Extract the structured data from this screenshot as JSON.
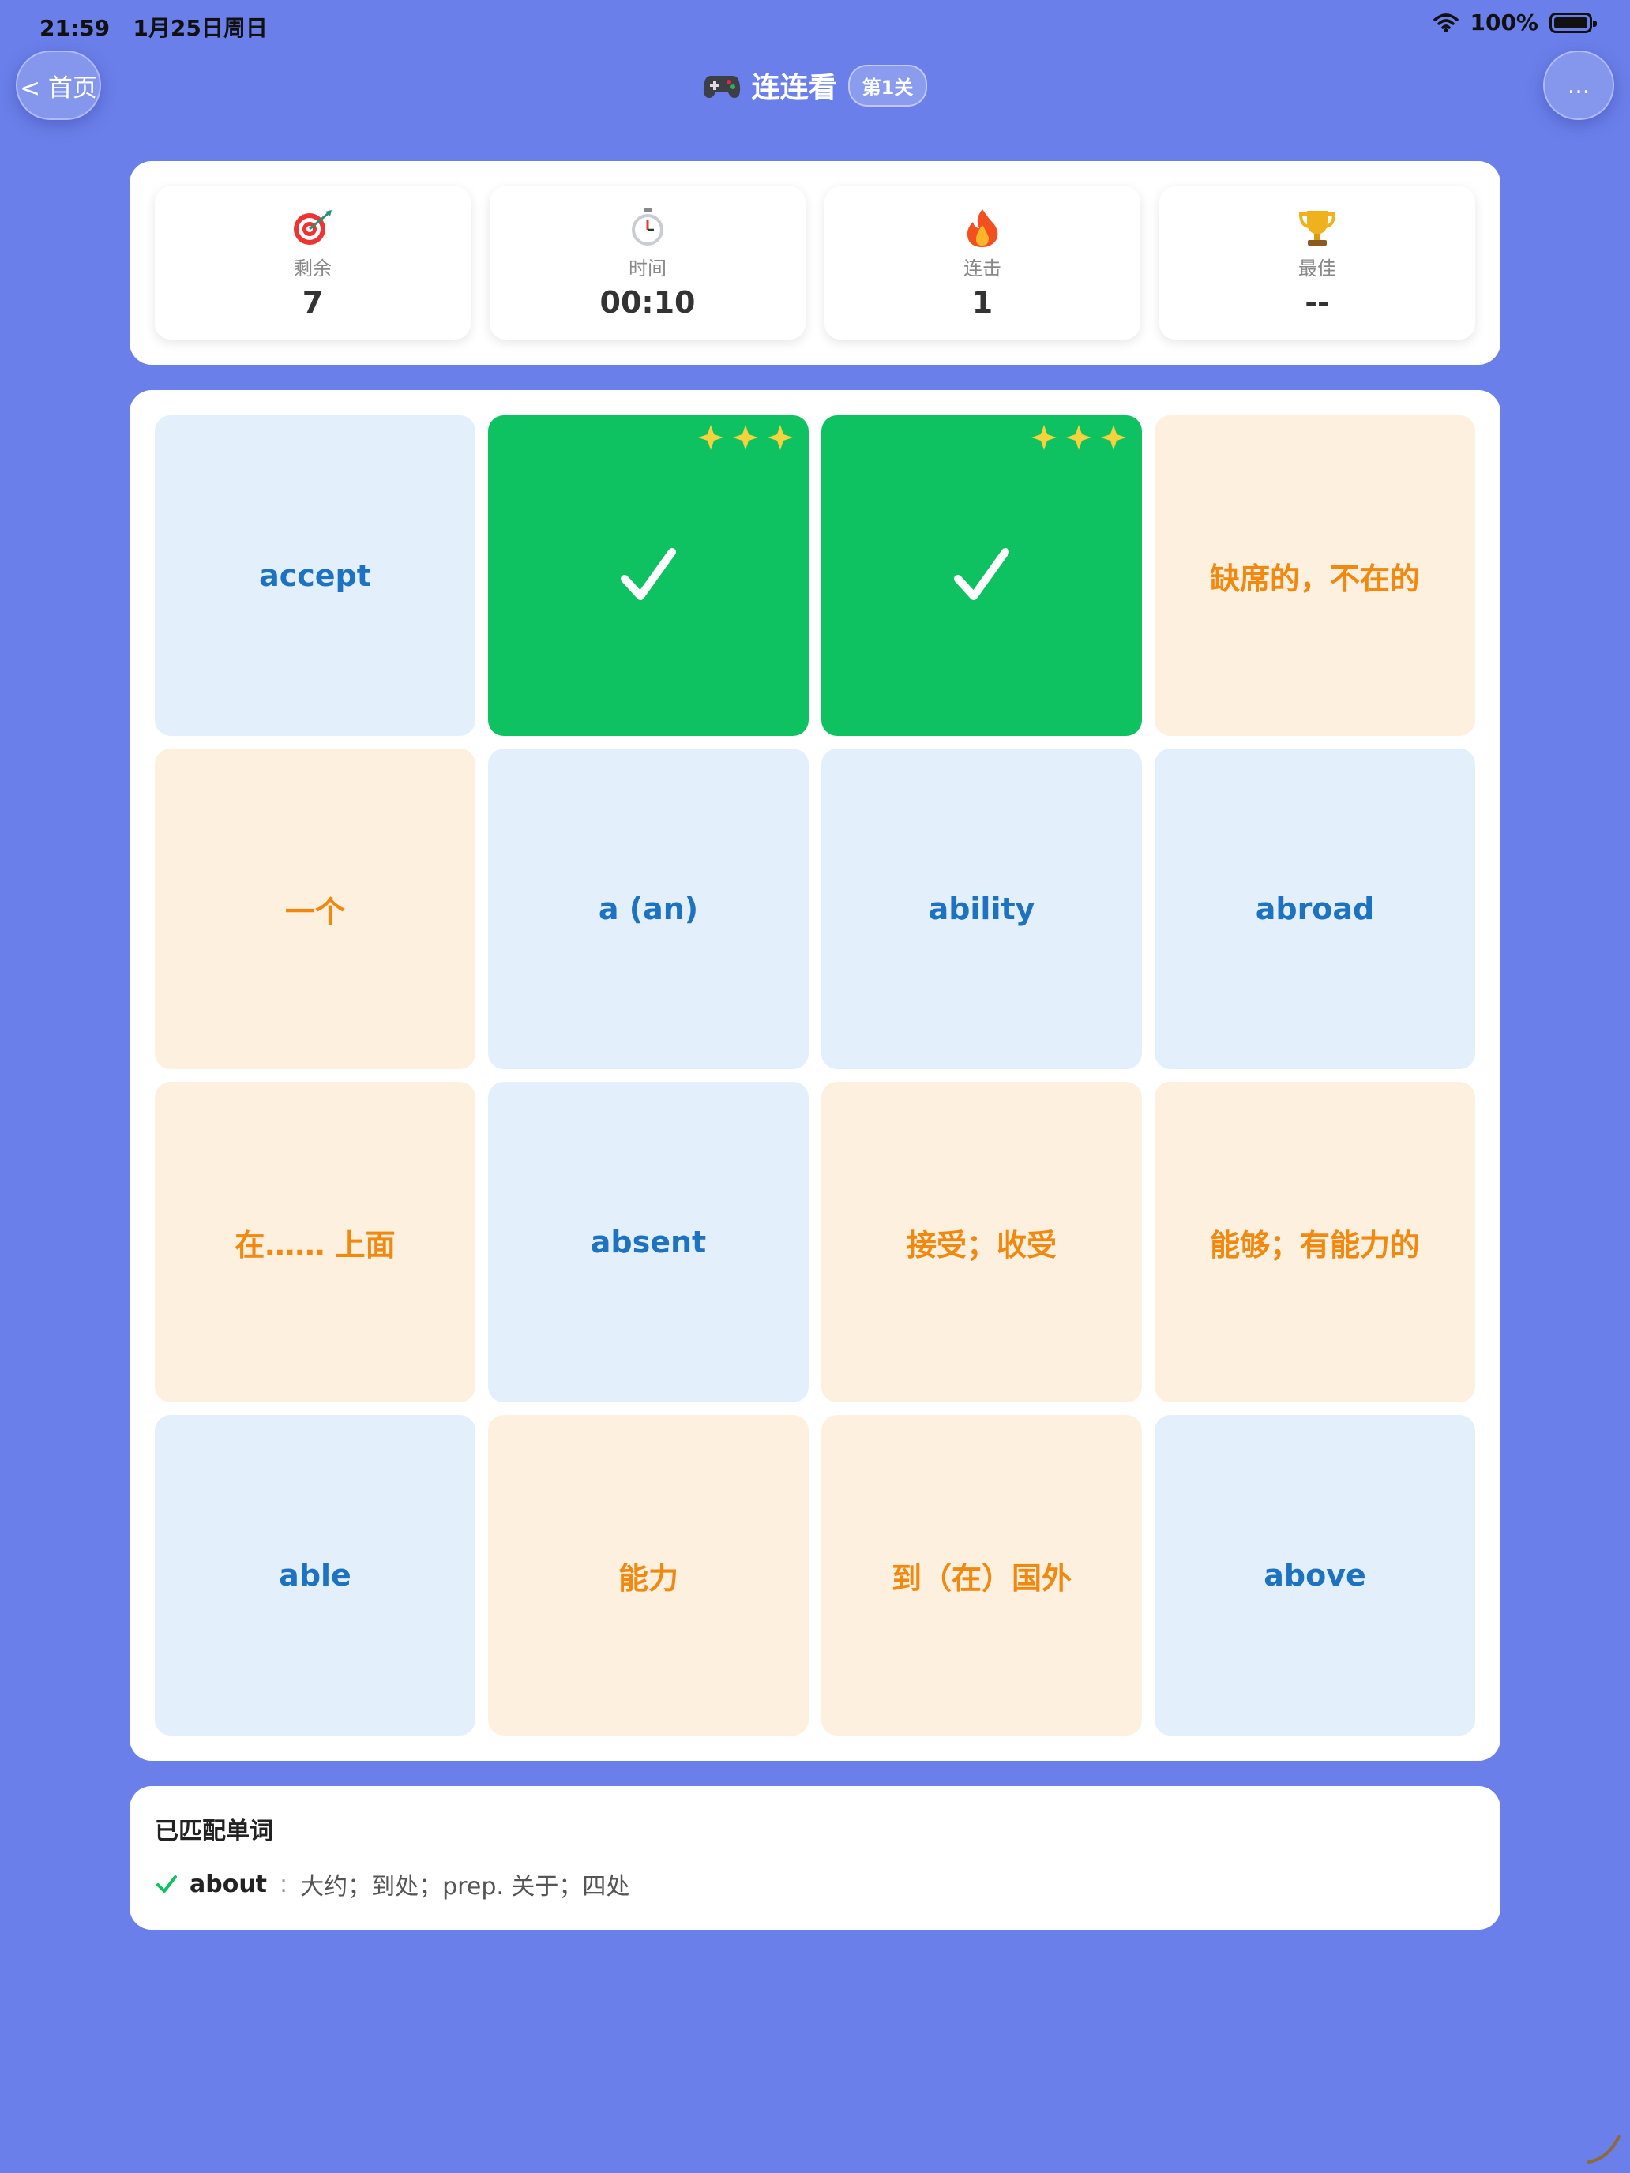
{
  "status": {
    "time": "21:59",
    "date": "1月25日周日",
    "battery": "100%"
  },
  "nav": {
    "back_label": "< 首页",
    "title": "连连看",
    "level_badge": "第1关",
    "more_label": "..."
  },
  "stats": [
    {
      "icon": "target-icon",
      "label": "剩余",
      "value": "7"
    },
    {
      "icon": "stopwatch-icon",
      "label": "时间",
      "value": "00:10"
    },
    {
      "icon": "fire-icon",
      "label": "连击",
      "value": "1"
    },
    {
      "icon": "trophy-icon",
      "label": "最佳",
      "value": "--"
    }
  ],
  "tiles": [
    {
      "text": "accept",
      "kind": "en"
    },
    {
      "text": "",
      "kind": "matched"
    },
    {
      "text": "",
      "kind": "matched"
    },
    {
      "text": "缺席的，不在的",
      "kind": "zh"
    },
    {
      "text": "一个",
      "kind": "zh"
    },
    {
      "text": "a (an)",
      "kind": "en"
    },
    {
      "text": "ability",
      "kind": "en"
    },
    {
      "text": "abroad",
      "kind": "en"
    },
    {
      "text": "在…… 上面",
      "kind": "zh"
    },
    {
      "text": "absent",
      "kind": "en"
    },
    {
      "text": "接受；收受",
      "kind": "zh"
    },
    {
      "text": "能够；有能力的",
      "kind": "zh"
    },
    {
      "text": "able",
      "kind": "en"
    },
    {
      "text": "能力",
      "kind": "zh"
    },
    {
      "text": "到（在）国外",
      "kind": "zh"
    },
    {
      "text": "above",
      "kind": "en"
    }
  ],
  "matched": {
    "title": "已匹配单词",
    "items": [
      {
        "word": "about",
        "separator": ":",
        "definition": "大约；到处；prep. 关于；四处"
      }
    ]
  },
  "colors": {
    "background": "#6b7fea",
    "english_tile": "#e3f0fb",
    "english_text": "#1e72c2",
    "chinese_tile": "#fdf0df",
    "chinese_text": "#f1880f",
    "matched_tile": "#0ec262"
  }
}
